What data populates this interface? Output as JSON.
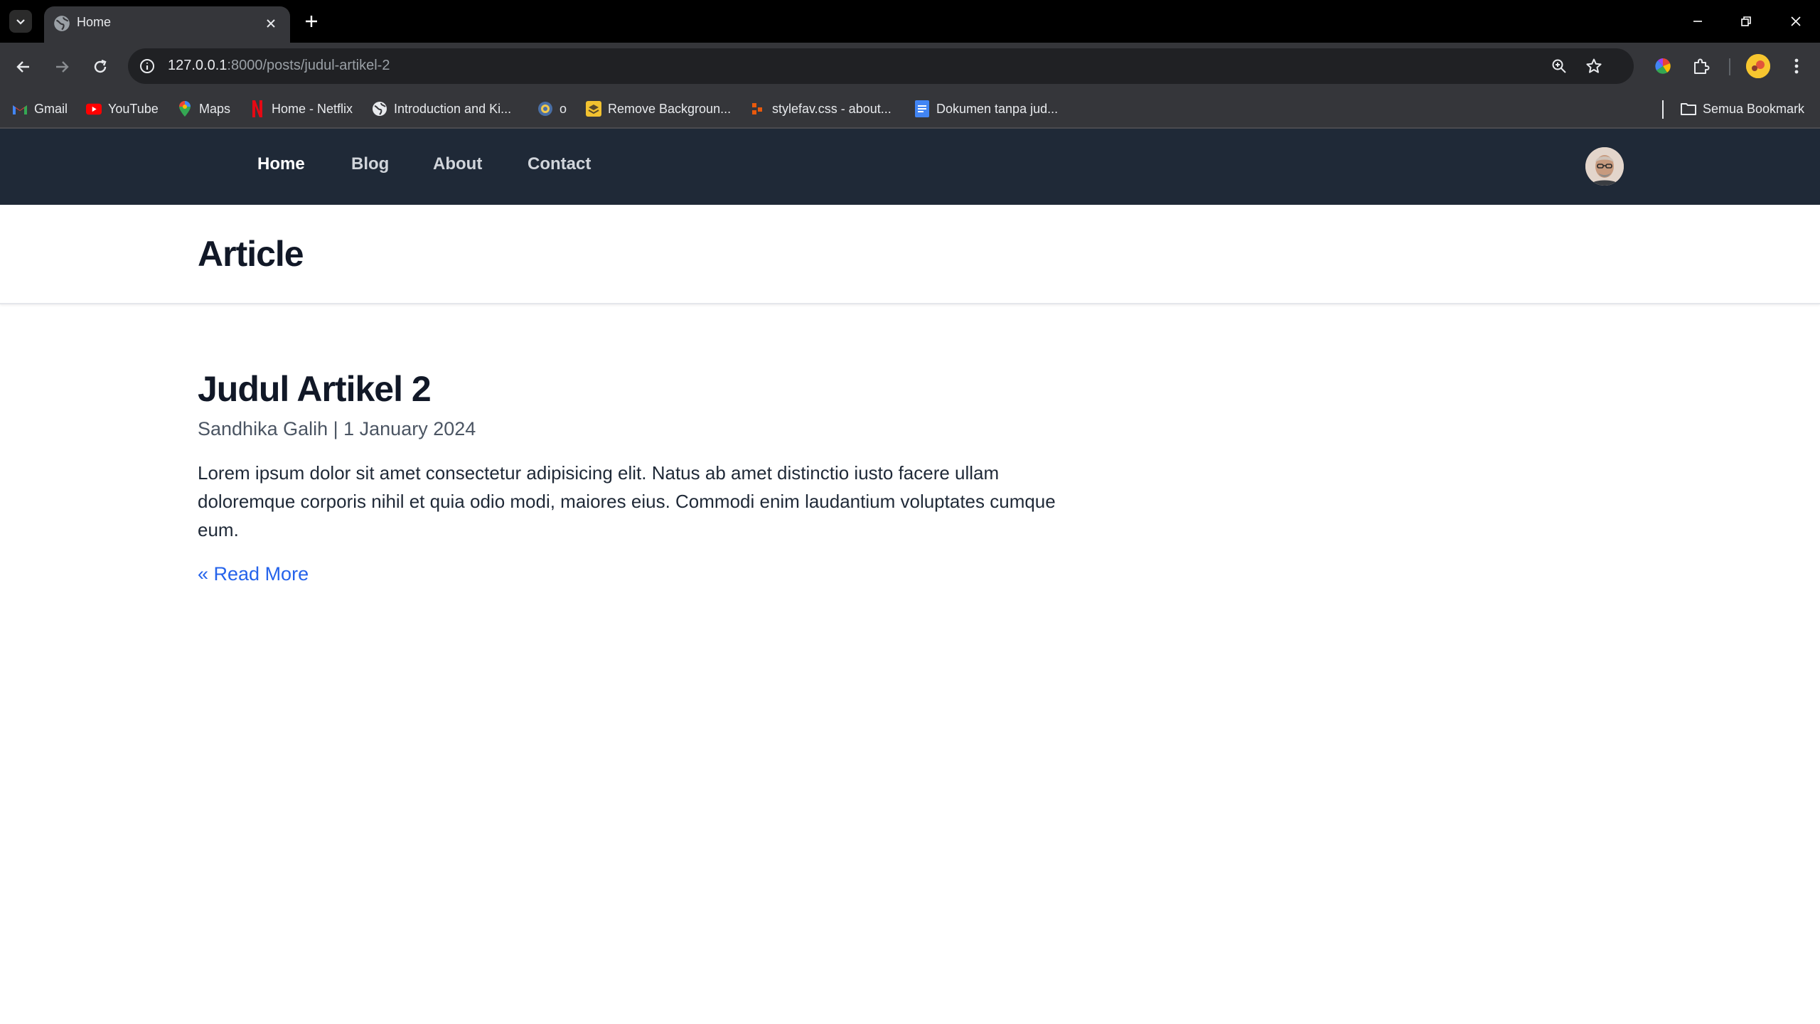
{
  "browser": {
    "tab_title": "Home",
    "url_host": "127.0.0.1",
    "url_path": ":8000/posts/judul-artikel-2",
    "bookmarks": [
      {
        "label": "Gmail",
        "icon": "gmail-icon"
      },
      {
        "label": "YouTube",
        "icon": "youtube-icon"
      },
      {
        "label": "Maps",
        "icon": "maps-icon"
      },
      {
        "label": "Home - Netflix",
        "icon": "netflix-icon"
      },
      {
        "label": "Introduction and Ki...",
        "icon": "globe-icon"
      },
      {
        "label": "o",
        "icon": "circle-logo-icon"
      },
      {
        "label": "Remove Backgroun...",
        "icon": "remove-bg-icon"
      },
      {
        "label": "stylefav.css - about...",
        "icon": "codepen-icon"
      },
      {
        "label": "Dokumen tanpa jud...",
        "icon": "docs-icon"
      }
    ],
    "all_bookmarks": "Semua Bookmark"
  },
  "navbar": {
    "links": [
      "Home",
      "Blog",
      "About",
      "Contact"
    ],
    "active": "Home"
  },
  "header": {
    "title": "Article"
  },
  "article": {
    "title": "Judul Artikel 2",
    "author": "Sandhika Galih",
    "date": "1 January 2024",
    "meta": "Sandhika Galih | 1 January 2024",
    "body": "Lorem ipsum dolor sit amet consectetur adipisicing elit. Natus ab amet distinctio iusto facere ullam doloremque corporis nihil et quia odio modi, maiores eius. Commodi enim laudantium voluptates cumque eum.",
    "read_more": "« Read More"
  },
  "colors": {
    "navbar_bg": "#1f2937",
    "link": "#2563eb",
    "heading": "#111827"
  }
}
